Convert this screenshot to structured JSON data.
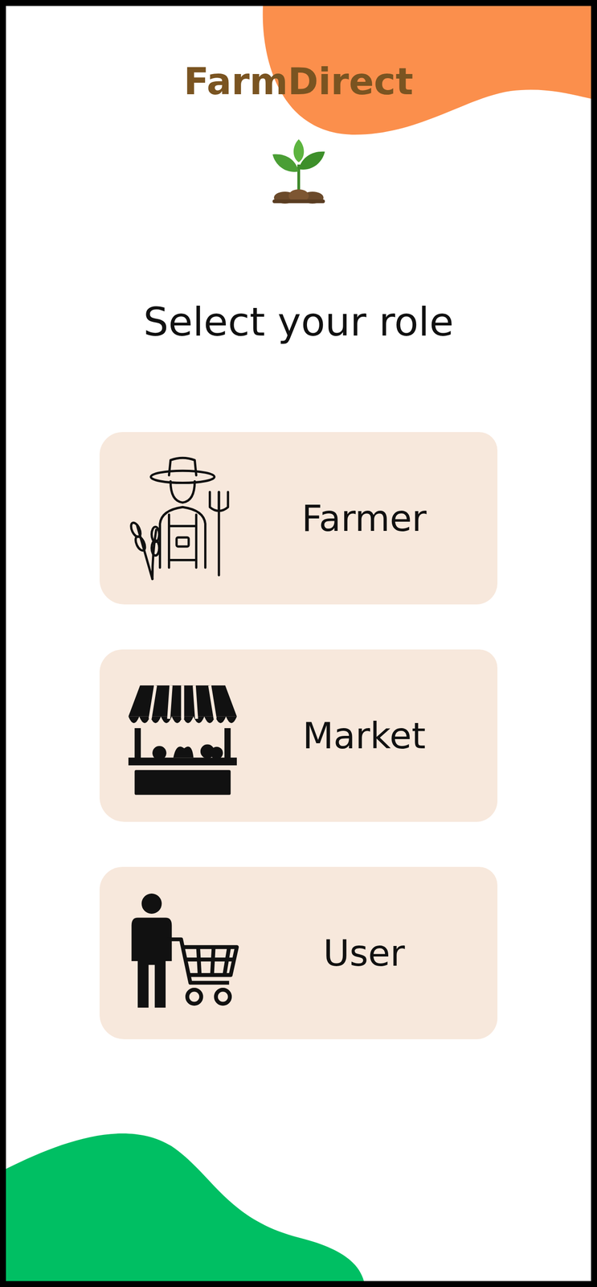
{
  "logo": "FarmDirect",
  "heading": "Select your role",
  "roles": [
    {
      "label": "Farmer"
    },
    {
      "label": "Market"
    },
    {
      "label": "User"
    }
  ]
}
